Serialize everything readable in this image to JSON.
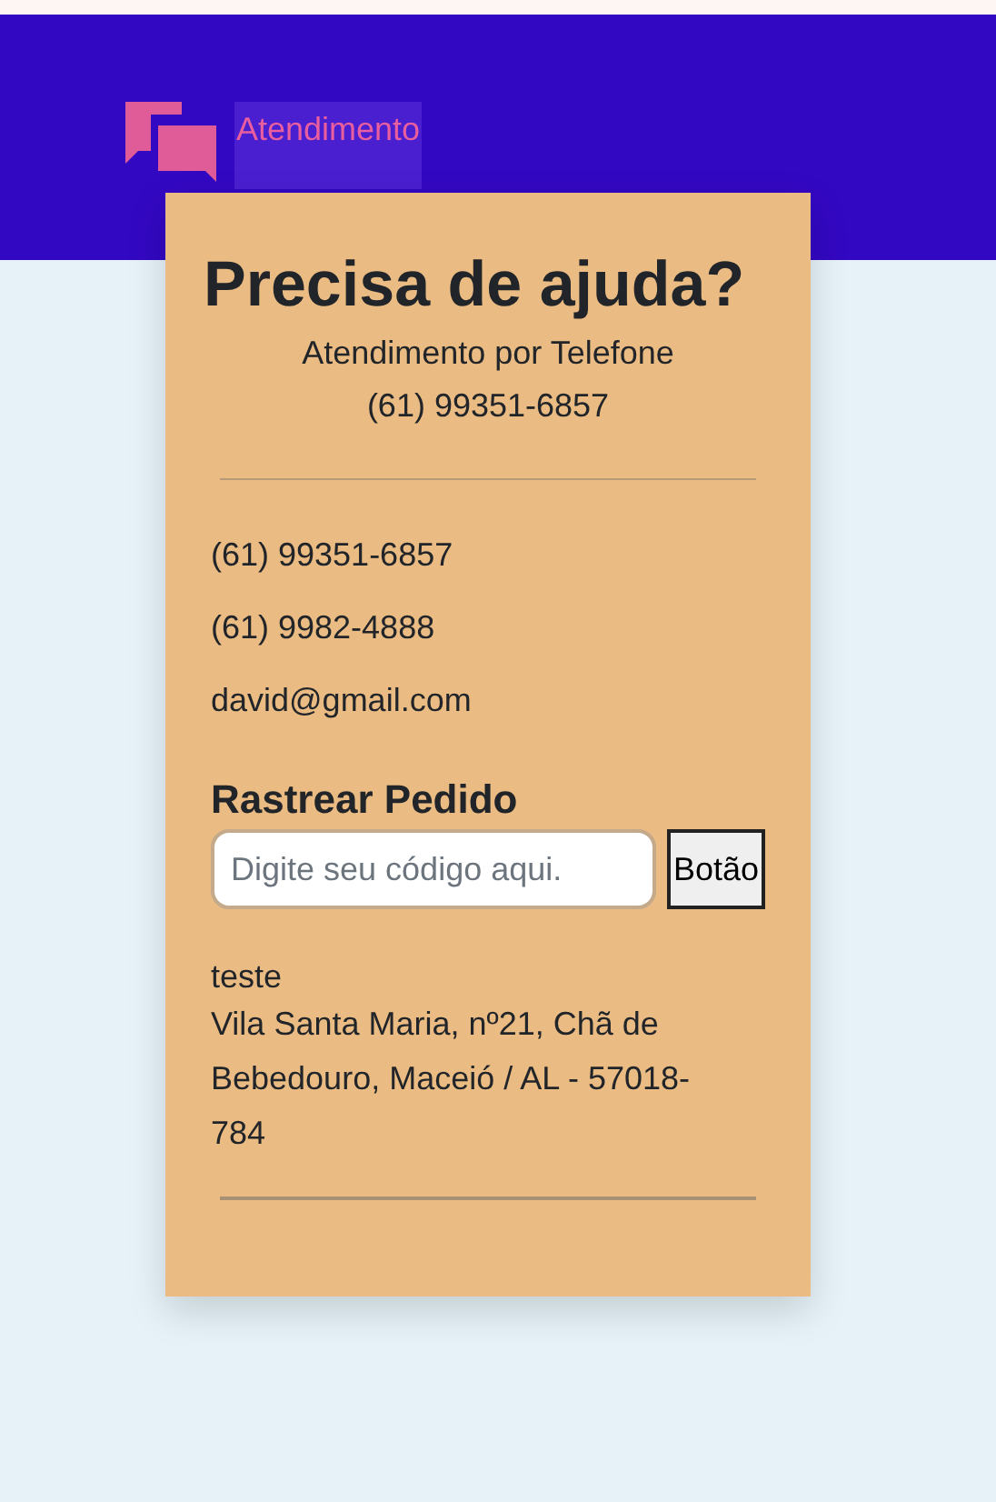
{
  "header": {
    "link": "Atendimento"
  },
  "card": {
    "title": "Precisa de ajuda?",
    "subtitle": "Atendimento por Telefone",
    "phone": "(61) 99351-6857",
    "contacts": [
      "(61) 99351-6857",
      "(61) 9982-4888",
      "david@gmail.com"
    ],
    "tracking": {
      "title": "Rastrear Pedido",
      "placeholder": "Digite seu código aqui.",
      "button": "Botão"
    },
    "address": {
      "label": "teste",
      "text": "Vila Santa Maria, nº21, Chã de Bebedouro, Maceió / AL - 57018-784"
    }
  }
}
